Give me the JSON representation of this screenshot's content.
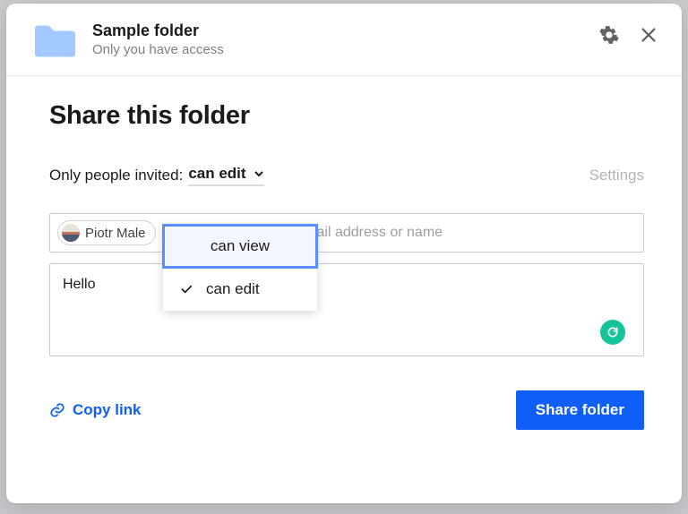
{
  "header": {
    "folder_name": "Sample folder",
    "access_text": "Only you have access"
  },
  "body": {
    "title": "Share this folder",
    "perm_label_prefix": "Only people invited:",
    "perm_current": "can edit",
    "settings_label": "Settings",
    "recipient_chip_name": "Piotr Male",
    "recipient_placeholder": "ail address or name",
    "message_text": "Hello"
  },
  "dropdown": {
    "items": [
      {
        "label": "can view",
        "selected": false,
        "highlighted": true
      },
      {
        "label": "can edit",
        "selected": true,
        "highlighted": false
      }
    ]
  },
  "footer": {
    "copy_link_label": "Copy link",
    "share_button_label": "Share folder"
  },
  "colors": {
    "primary": "#0f5ef7",
    "grammarly": "#15c39a"
  }
}
